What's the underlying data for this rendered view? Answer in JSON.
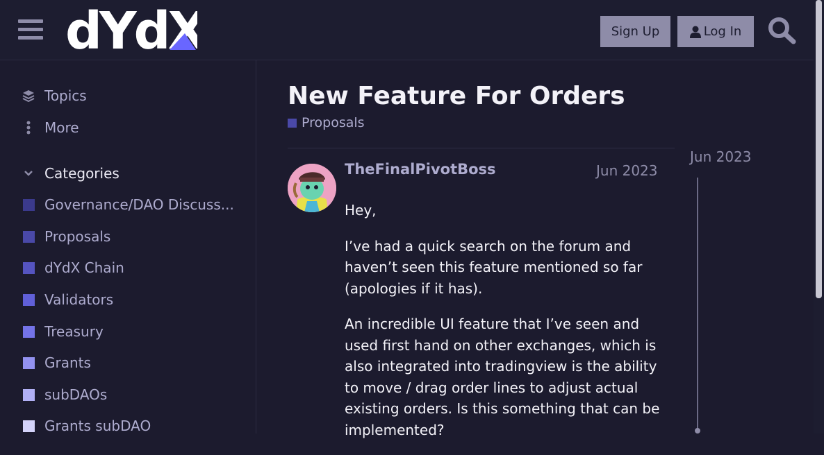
{
  "header": {
    "logo_text": "dYdX",
    "signup_label": "Sign Up",
    "login_label": "Log In",
    "icons": [
      "hamburger-icon",
      "user-icon",
      "search-icon"
    ]
  },
  "sidebar": {
    "nav": [
      {
        "label": "Topics",
        "icon": "layers-icon"
      },
      {
        "label": "More",
        "icon": "vertical-ellipsis-icon"
      }
    ],
    "categories_label": "Categories",
    "categories": [
      {
        "label": "Governance/DAO Discuss...",
        "color": "#3b3a8c"
      },
      {
        "label": "Proposals",
        "color": "#4a49a8"
      },
      {
        "label": "dYdX Chain",
        "color": "#5554c0"
      },
      {
        "label": "Validators",
        "color": "#6160d8"
      },
      {
        "label": "Treasury",
        "color": "#7473e8"
      },
      {
        "label": "Grants",
        "color": "#9392f0"
      },
      {
        "label": "subDAOs",
        "color": "#b1b0f5"
      },
      {
        "label": "Grants subDAO",
        "color": "#d4d3fa"
      }
    ]
  },
  "topic": {
    "title": "New Feature For Orders",
    "category": "Proposals",
    "category_color": "#4a49a8"
  },
  "post": {
    "username": "TheFinalPivotBoss",
    "date": "Jun 2023",
    "paragraphs": [
      "Hey,",
      "I’ve had a quick search on the forum and haven’t seen this feature mentioned so far (apologies if it has).",
      "An incredible UI feature that I’ve seen and used first hand on other exchanges, which is also integrated into tradingview is the ability to move / drag order lines to adjust actual existing orders. Is this something that can be implemented?"
    ]
  },
  "timeline": {
    "date": "Jun 2023"
  },
  "colors": {
    "background": "#1c1b2e",
    "header": "#1d1d30",
    "accent": "#8e8ca8",
    "logo_accent": "#6966ff"
  }
}
